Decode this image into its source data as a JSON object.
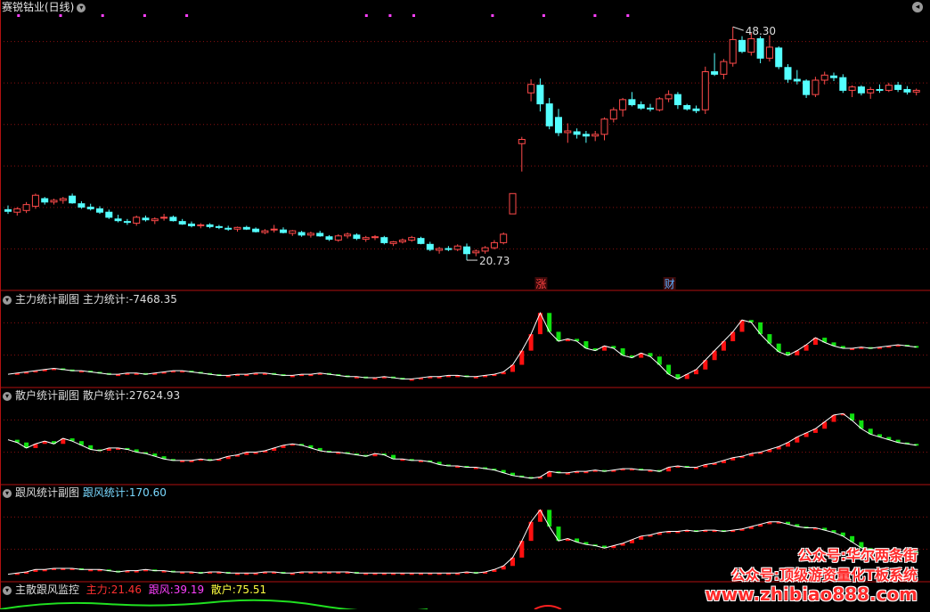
{
  "main_panel": {
    "title": "赛锐钴业(日线)",
    "high_label": "48.30",
    "low_label": "20.73",
    "tags": [
      {
        "text": "涨",
        "color": "#ff4040"
      },
      {
        "text": "财",
        "color": "#5aaaff"
      }
    ]
  },
  "panels": [
    {
      "title": "主力统计副图",
      "stat_label": "主力统计:",
      "stat_value": "-7468.35",
      "label_color": "#dcdcdc"
    },
    {
      "title": "散户统计副图",
      "stat_label": "散户统计:",
      "stat_value": "27624.93",
      "label_color": "#dcdcdc"
    },
    {
      "title": "跟风统计副图",
      "stat_label": "跟风统计:",
      "stat_value": "170.60",
      "label_color": "#7ad9ff"
    },
    {
      "title": "主散跟风监控"
    }
  ],
  "bottom_legend": [
    {
      "label": "主力:",
      "value": "21.46",
      "color": "#ff3030"
    },
    {
      "label": "跟风:",
      "value": "39.19",
      "color": "#ff40ff"
    },
    {
      "label": "散户:",
      "value": "75.51",
      "color": "#ffff40"
    }
  ],
  "watermark": {
    "line1": "公众号:华尔两条街",
    "line2": "公众号:顶级游资量化T板系统",
    "line3": "www.zhibiao888.com"
  },
  "colors": {
    "up": "#ff4a4a",
    "down": "#54ffff",
    "line": "#ffffff",
    "grid": "#8a1010",
    "bar_up": "#ff1010",
    "bar_down": "#10e010"
  },
  "chart_data": [
    {
      "type": "candlestick",
      "title": "赛锐钴业(日线)",
      "ylim": [
        18,
        50
      ],
      "annotations": [
        {
          "text": "48.30",
          "type": "high"
        },
        {
          "text": "20.73",
          "type": "low"
        }
      ],
      "candles": [
        [
          26.7,
          27.2,
          26.2,
          26.5
        ],
        [
          26.4,
          27.0,
          26.0,
          26.8
        ],
        [
          26.6,
          27.6,
          26.3,
          27.3
        ],
        [
          27.1,
          28.6,
          26.8,
          28.4
        ],
        [
          28.0,
          28.2,
          27.3,
          27.6
        ],
        [
          27.6,
          28.0,
          27.3,
          27.8
        ],
        [
          27.8,
          28.2,
          27.4,
          28.0
        ],
        [
          28.3,
          28.6,
          27.4,
          27.5
        ],
        [
          27.4,
          27.7,
          26.8,
          27.0
        ],
        [
          27.0,
          27.4,
          26.6,
          26.8
        ],
        [
          26.8,
          27.1,
          26.2,
          26.4
        ],
        [
          26.4,
          26.7,
          25.6,
          25.8
        ],
        [
          25.6,
          26.1,
          25.2,
          25.4
        ],
        [
          25.3,
          25.6,
          24.9,
          25.2
        ],
        [
          25.1,
          26.0,
          24.8,
          25.8
        ],
        [
          25.7,
          26.0,
          25.3,
          25.5
        ],
        [
          25.4,
          25.8,
          25.0,
          25.6
        ],
        [
          25.7,
          26.2,
          25.4,
          25.8
        ],
        [
          25.8,
          26.0,
          25.3,
          25.4
        ],
        [
          25.3,
          25.6,
          24.9,
          25.0
        ],
        [
          25.0,
          25.3,
          24.6,
          24.8
        ],
        [
          24.8,
          25.1,
          24.5,
          24.9
        ],
        [
          24.9,
          25.1,
          24.5,
          24.7
        ],
        [
          24.7,
          24.9,
          24.4,
          24.6
        ],
        [
          24.5,
          24.8,
          24.2,
          24.4
        ],
        [
          24.4,
          24.7,
          24.1,
          24.6
        ],
        [
          24.6,
          24.8,
          24.3,
          24.4
        ],
        [
          24.4,
          24.6,
          24.0,
          24.1
        ],
        [
          24.0,
          24.4,
          23.8,
          24.2
        ],
        [
          24.3,
          24.9,
          24.0,
          24.4
        ],
        [
          24.3,
          24.6,
          23.9,
          24.0
        ],
        [
          23.9,
          24.3,
          23.6,
          24.2
        ],
        [
          24.0,
          24.2,
          23.5,
          23.7
        ],
        [
          23.7,
          24.1,
          23.4,
          23.9
        ],
        [
          23.9,
          24.2,
          23.5,
          23.6
        ],
        [
          23.5,
          23.7,
          23.0,
          23.2
        ],
        [
          23.1,
          23.8,
          22.9,
          23.6
        ],
        [
          23.6,
          24.0,
          23.3,
          23.8
        ],
        [
          23.7,
          23.9,
          23.1,
          23.3
        ],
        [
          23.2,
          23.6,
          22.9,
          23.4
        ],
        [
          23.4,
          23.7,
          23.1,
          23.5
        ],
        [
          23.4,
          23.6,
          22.6,
          22.8
        ],
        [
          22.7,
          23.0,
          22.4,
          22.9
        ],
        [
          22.9,
          23.3,
          22.7,
          23.1
        ],
        [
          23.1,
          23.6,
          22.9,
          23.4
        ],
        [
          23.3,
          23.5,
          22.6,
          22.7
        ],
        [
          22.6,
          22.9,
          21.8,
          22.0
        ],
        [
          21.9,
          22.3,
          21.5,
          22.1
        ],
        [
          22.1,
          22.4,
          21.8,
          22.0
        ],
        [
          22.0,
          22.6,
          21.8,
          22.4
        ],
        [
          22.3,
          22.7,
          20.73,
          21.5
        ],
        [
          21.6,
          22.0,
          21.2,
          21.8
        ],
        [
          21.8,
          22.4,
          21.5,
          22.2
        ],
        [
          22.2,
          23.1,
          22.0,
          22.8
        ],
        [
          22.8,
          24.0,
          22.6,
          23.8
        ],
        [
          26.2,
          28.6,
          26.2,
          28.6
        ],
        [
          34.5,
          35.3,
          31.2,
          35.0
        ],
        [
          40.5,
          42.1,
          39.5,
          41.5
        ],
        [
          41.4,
          42.2,
          38.3,
          39.2
        ],
        [
          39.2,
          39.9,
          36.2,
          36.6
        ],
        [
          37.6,
          38.6,
          35.4,
          35.8
        ],
        [
          35.8,
          36.9,
          34.6,
          36.0
        ],
        [
          35.9,
          36.3,
          35.1,
          35.6
        ],
        [
          35.6,
          36.0,
          34.6,
          35.4
        ],
        [
          35.4,
          36.0,
          34.8,
          35.6
        ],
        [
          35.6,
          37.6,
          34.9,
          37.4
        ],
        [
          37.4,
          38.8,
          37.0,
          38.5
        ],
        [
          38.5,
          39.9,
          37.7,
          39.7
        ],
        [
          39.7,
          40.6,
          38.9,
          39.1
        ],
        [
          39.1,
          39.5,
          38.5,
          38.7
        ],
        [
          38.7,
          39.2,
          38.3,
          38.6
        ],
        [
          38.5,
          40.0,
          38.3,
          39.8
        ],
        [
          39.8,
          40.8,
          39.4,
          40.3
        ],
        [
          40.3,
          40.6,
          38.6,
          39.1
        ],
        [
          39.0,
          39.2,
          38.4,
          38.6
        ],
        [
          38.6,
          39.0,
          38.1,
          38.4
        ],
        [
          38.5,
          43.6,
          38.0,
          43.0
        ],
        [
          43.0,
          45.2,
          42.5,
          42.7
        ],
        [
          42.7,
          44.5,
          42.1,
          44.2
        ],
        [
          44.0,
          48.3,
          43.6,
          46.8
        ],
        [
          46.7,
          47.2,
          45.2,
          45.4
        ],
        [
          45.3,
          47.6,
          44.9,
          46.9
        ],
        [
          46.9,
          47.2,
          44.0,
          44.6
        ],
        [
          44.6,
          47.3,
          44.2,
          45.9
        ],
        [
          45.8,
          46.0,
          43.3,
          43.6
        ],
        [
          43.5,
          43.9,
          41.7,
          42.1
        ],
        [
          42.1,
          43.2,
          41.5,
          41.9
        ],
        [
          41.9,
          42.1,
          39.9,
          40.3
        ],
        [
          40.3,
          42.4,
          40.0,
          42.0
        ],
        [
          42.0,
          43.0,
          41.5,
          42.6
        ],
        [
          42.5,
          42.9,
          41.9,
          42.3
        ],
        [
          42.3,
          42.7,
          40.5,
          40.8
        ],
        [
          40.8,
          41.4,
          40.0,
          41.2
        ],
        [
          41.2,
          41.4,
          40.2,
          40.5
        ],
        [
          40.5,
          41.2,
          39.8,
          40.9
        ],
        [
          40.9,
          41.5,
          40.5,
          40.8
        ],
        [
          40.8,
          41.7,
          40.6,
          41.4
        ],
        [
          41.4,
          41.8,
          40.6,
          40.9
        ],
        [
          40.9,
          41.3,
          40.3,
          40.6
        ],
        [
          40.6,
          41.0,
          40.2,
          40.8
        ]
      ],
      "top_markers_count": 12
    },
    {
      "type": "bar+line",
      "title": "主力统计副图",
      "values": [
        -6,
        -5,
        -4,
        -3,
        -2,
        -1,
        -2,
        -3,
        -3,
        -4,
        -5,
        -6,
        -6,
        -5,
        -5,
        -6,
        -5,
        -4,
        -3,
        -3,
        -4,
        -5,
        -6,
        -7,
        -7,
        -6,
        -6,
        -5,
        -5,
        -6,
        -7,
        -7,
        -6,
        -6,
        -5,
        -6,
        -7,
        -8,
        -8,
        -9,
        -9,
        -8,
        -9,
        -10,
        -10,
        -9,
        -8,
        -8,
        -7,
        -7,
        -8,
        -8,
        -7,
        -6,
        -4,
        2,
        14,
        28,
        46,
        30,
        22,
        24,
        22,
        16,
        14,
        18,
        16,
        10,
        8,
        12,
        9,
        2,
        -6,
        -10,
        -6,
        -2,
        6,
        14,
        22,
        30,
        40,
        38,
        28,
        20,
        13,
        10,
        14,
        19,
        25,
        21,
        18,
        16,
        16,
        17,
        16,
        17,
        18,
        19,
        18,
        17
      ],
      "ylim": [
        -15,
        50
      ]
    },
    {
      "type": "bar+line",
      "title": "散户统计副图",
      "values": [
        30,
        28,
        24,
        27,
        29,
        27,
        31,
        29,
        26,
        23,
        22,
        24,
        24,
        23,
        21,
        20,
        18,
        16,
        15,
        15,
        15,
        16,
        15,
        16,
        18,
        19,
        21,
        21,
        22,
        24,
        26,
        27,
        26,
        24,
        22,
        21,
        21,
        20,
        19,
        18,
        20,
        19,
        16,
        16,
        15,
        15,
        14,
        12,
        11,
        11,
        10,
        10,
        9,
        8,
        6,
        4,
        3,
        2,
        3,
        7,
        6,
        6,
        7,
        7,
        8,
        7,
        8,
        9,
        9,
        8,
        8,
        7,
        10,
        11,
        10,
        10,
        12,
        13,
        15,
        17,
        18,
        20,
        21,
        23,
        25,
        28,
        32,
        35,
        38,
        43,
        48,
        49,
        44,
        38,
        34,
        32,
        30,
        28,
        27,
        26
      ],
      "ylim": [
        0,
        55
      ]
    },
    {
      "type": "bar+line",
      "title": "跟风统计副图",
      "values": [
        4,
        5,
        6,
        8,
        8,
        9,
        9,
        9,
        8,
        8,
        8,
        7,
        6,
        7,
        7,
        8,
        7,
        7,
        6,
        6,
        6,
        5,
        6,
        6,
        5,
        5,
        5,
        5,
        6,
        6,
        5,
        5,
        6,
        6,
        6,
        6,
        6,
        6,
        5,
        5,
        5,
        5,
        5,
        5,
        5,
        5,
        5,
        5,
        5,
        5,
        6,
        5,
        6,
        8,
        11,
        18,
        32,
        48,
        58,
        44,
        32,
        34,
        31,
        29,
        28,
        26,
        28,
        30,
        33,
        36,
        37,
        39,
        40,
        40,
        41,
        40,
        41,
        41,
        40,
        41,
        42,
        44,
        46,
        48,
        48,
        46,
        44,
        43,
        43,
        41,
        39,
        36,
        31,
        26,
        25,
        24,
        24,
        23,
        23,
        22
      ],
      "ylim": [
        0,
        65
      ]
    },
    {
      "type": "line",
      "title": "主散跟风监控",
      "series": [
        {
          "name": "主力",
          "values": [
            21.46
          ]
        },
        {
          "name": "跟风",
          "values": [
            39.19
          ]
        },
        {
          "name": "散户",
          "values": [
            75.51
          ]
        }
      ]
    }
  ]
}
